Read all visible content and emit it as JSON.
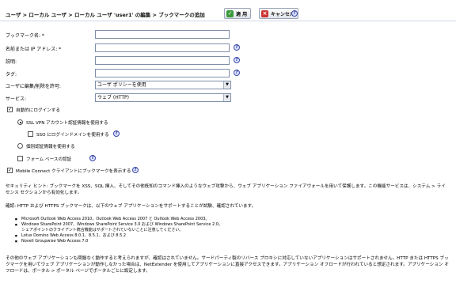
{
  "header": {
    "breadcrumb": "ユーザ > ローカル ユーザ > ローカル ユーザ 'user1' の編集 > ブックマークの追加",
    "apply_label": "適 用",
    "cancel_label": "キャンセル"
  },
  "form": {
    "bookmark_name_label": "ブックマーク名: *",
    "bookmark_name_value": "",
    "host_label": "名前または IP アドレス: *",
    "host_value": "",
    "description_label": "説明:",
    "description_value": "",
    "tag_label": "タグ:",
    "tag_value": "",
    "user_edit_label": "ユーザに編集/削除を許可:",
    "user_edit_selected": "ユーザ ポリシーを使用",
    "service_label": "サービス:",
    "service_selected": "ウェブ (HTTP)"
  },
  "options": {
    "auto_login_label": "自動的にログインする",
    "auto_login_checked": true,
    "ssl_vpn_label": "SSL VPN アカウント認証情報を使用する",
    "sso_domain_label": "SSO にログインドメインを使用する",
    "custom_label": "個別認証情報を使用する",
    "form_based_label": "フォーム ベースの認証",
    "mobile_connect_label": "Mobile Connect クライアントにブックマークを表示する",
    "mobile_connect_checked": true
  },
  "notes": {
    "security_hint": "セキュリティ ヒント: ブックマークを XSS、SQL 挿入、そしてその他既知のコマンド挿入のようなウェブ攻撃から、ウェブ アプリケーション ファイアウォールを用いて保護します。この機能サービスは、システム > ライセンス セクションから有効化します。",
    "confirmation": "確認: HTTP および HTTPS ブックマークは、以下のウェブ アプリケーションをサポートすることが試験、確認されています。",
    "apps": [
      "Microsoft Outlook Web Access 2010、Outlook Web Access 2007 と Outlook Web Access 2003。",
      "Windows SharePoint 2007、Windows SharePoint Service 3.0 および Windows SharePoint Service 2.0。",
      "シェアポイントのクライアント統合機能はサポートされていないことに注意してください。",
      "Lotus Domino Web Access 8.0.1、8.5.1、および 8.5.2",
      "Novell Groupwise Web Access 7.0"
    ],
    "footer": "その他のウェブ アプリケーションも問題なく動作すると考えられますが、確認はされていません。サードパーティ製のリバース プロキシに対応していないアプリケーションはサポートされません。HTTP または HTTPS ブックマークを用いてウェブ アプリケーションが動作しなかった場合は、NetExtender を使用してアプリケーションに直接アクセスできます。アプリケーション オフロードが行われていると想定されます。アプリケーション オフロードは、ポータル > ポータル ページでポータルごとに設定します。"
  }
}
